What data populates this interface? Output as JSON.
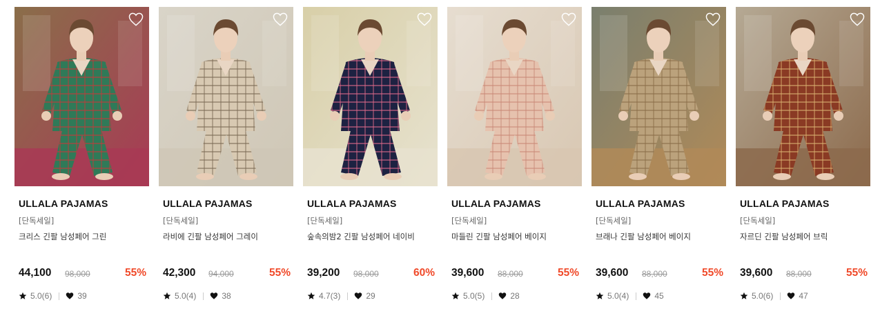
{
  "products": [
    {
      "brand": "ULLALA PAJAMAS",
      "tag": "[단독세일]",
      "name": "크리스 긴팔 남성페어 그린",
      "price": "44,100",
      "original_price": "98,000",
      "discount": "55%",
      "rating": "5.0(6)",
      "likes": "39",
      "image": {
        "bg": "#8a6e4a",
        "floor": "#a83a55",
        "outfit": "#2f7a58",
        "accent": "#c23a3a"
      }
    },
    {
      "brand": "ULLALA PAJAMAS",
      "tag": "[단독세일]",
      "name": "라비에 긴팔 남성페어 그레이",
      "price": "42,300",
      "original_price": "94,000",
      "discount": "55%",
      "rating": "5.0(4)",
      "likes": "38",
      "image": {
        "bg": "#d9d4c8",
        "floor": "#cfc7b6",
        "outfit": "#d8c9b2",
        "accent": "#7b6a55"
      }
    },
    {
      "brand": "ULLALA PAJAMAS",
      "tag": "[단독세일]",
      "name": "숲속의밤2 긴팔 남성페어 네이비",
      "price": "39,200",
      "original_price": "98,000",
      "discount": "60%",
      "rating": "4.7(3)",
      "likes": "29",
      "image": {
        "bg": "#d8cfa8",
        "floor": "#e7e2cf",
        "outfit": "#1d2242",
        "accent": "#e06a8a"
      }
    },
    {
      "brand": "ULLALA PAJAMAS",
      "tag": "[단독세일]",
      "name": "마들린 긴팔 남성페어 베이지",
      "price": "39,600",
      "original_price": "88,000",
      "discount": "55%",
      "rating": "5.0(5)",
      "likes": "28",
      "image": {
        "bg": "#e6ddd0",
        "floor": "#d8c7b2",
        "outfit": "#e6c2ae",
        "accent": "#c98a78"
      }
    },
    {
      "brand": "ULLALA PAJAMAS",
      "tag": "[단독세일]",
      "name": "브래나 긴팔 남성페어 베이지",
      "price": "39,600",
      "original_price": "88,000",
      "discount": "55%",
      "rating": "5.0(4)",
      "likes": "45",
      "image": {
        "bg": "#7a7f6e",
        "floor": "#b08a58",
        "outfit": "#bba27c",
        "accent": "#8a6d48"
      }
    },
    {
      "brand": "ULLALA PAJAMAS",
      "tag": "[단독세일]",
      "name": "자르딘 긴팔 남성페어 브릭",
      "price": "39,600",
      "original_price": "88,000",
      "discount": "55%",
      "rating": "5.0(6)",
      "likes": "47",
      "image": {
        "bg": "#b5a994",
        "floor": "#8c6a4c",
        "outfit": "#8a3a24",
        "accent": "#d9b070"
      }
    }
  ],
  "colors": {
    "discount": "#f04a2a",
    "heart_outline": "#ffffff",
    "star": "#111111"
  },
  "icons": {
    "wishlist": "heart-outline-icon",
    "rating": "star-icon",
    "likes": "heart-filled-icon"
  }
}
